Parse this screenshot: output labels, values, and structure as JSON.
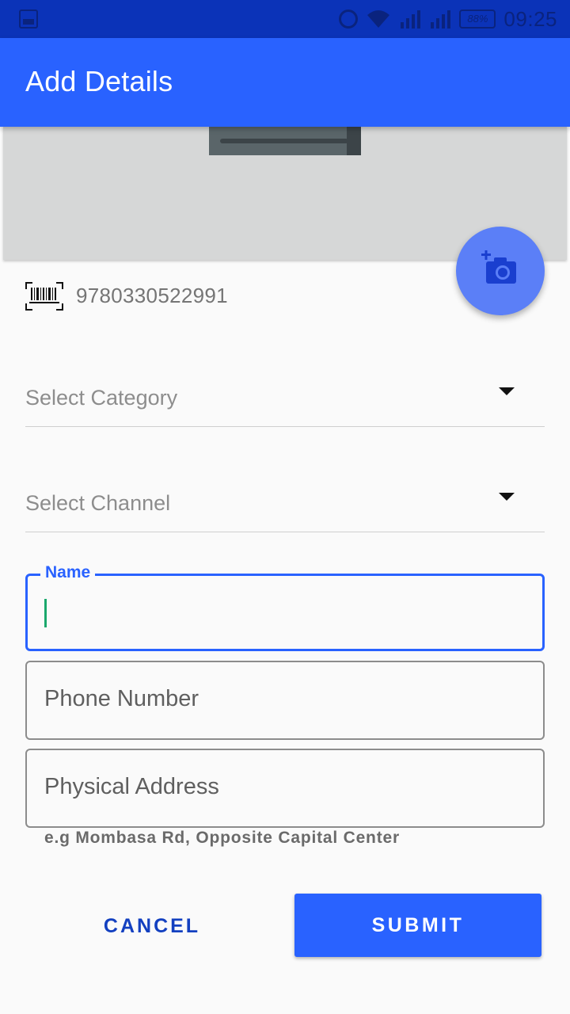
{
  "status_bar": {
    "battery": "88%",
    "time": "09:25"
  },
  "app_bar": {
    "title": "Add Details"
  },
  "fab": {
    "icon": "add-photo-icon"
  },
  "barcode": {
    "icon": "barcode-scan-icon",
    "value": "9780330522991"
  },
  "dropdowns": {
    "category": {
      "label": "Select Category"
    },
    "channel": {
      "label": "Select Channel"
    }
  },
  "fields": {
    "name": {
      "label": "Name",
      "value": ""
    },
    "phone": {
      "placeholder": "Phone Number"
    },
    "address": {
      "placeholder": "Physical Address",
      "helper": "e.g Mombasa Rd, Opposite Capital Center"
    }
  },
  "buttons": {
    "cancel": "CANCEL",
    "submit": "SUBMIT"
  },
  "colors": {
    "primary": "#2962ff",
    "status_bar": "#0b33b8",
    "fab": "#5b7ff7"
  }
}
